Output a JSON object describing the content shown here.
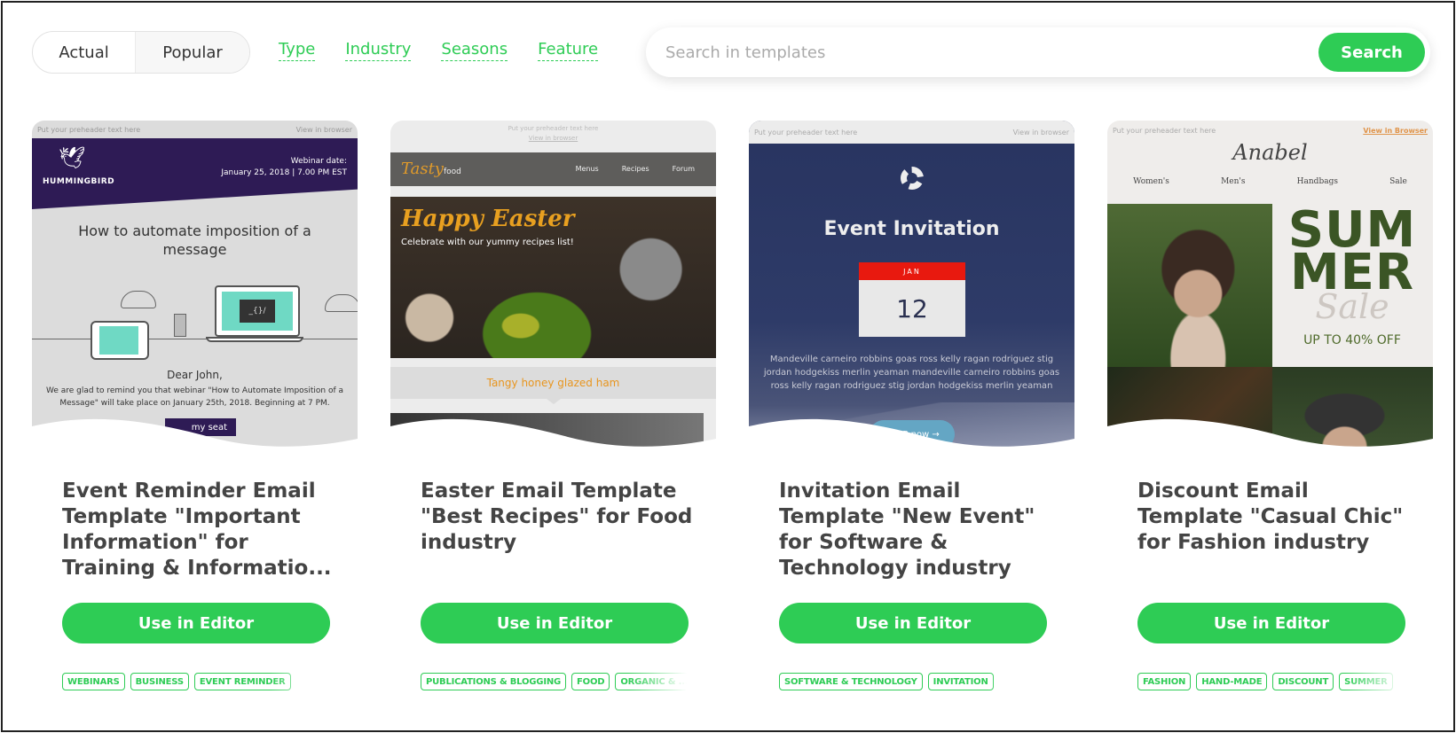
{
  "toolbar": {
    "sort_tabs": [
      {
        "label": "Actual",
        "active": false
      },
      {
        "label": "Popular",
        "active": true
      }
    ],
    "filters": [
      "Type",
      "Industry",
      "Seasons",
      "Feature"
    ],
    "search": {
      "placeholder": "Search in templates",
      "value": "",
      "button_label": "Search"
    }
  },
  "colors": {
    "accent": "#2ecc55",
    "title_text": "#444444"
  },
  "cards": [
    {
      "title": "Event Reminder Email Template \"Important Information\" for Training & Informatio...",
      "button_label": "Use in Editor",
      "tags": [
        "WEBINARS",
        "BUSINESS",
        "EVENT REMINDER"
      ],
      "preview": {
        "preheader": "Put your preheader text here",
        "view_link": "View in browser",
        "brand": "HUMMINGBIRD",
        "webinar_label": "Webinar date:",
        "webinar_date": "January 25, 2018 | 7.00 PM EST",
        "headline": "How to automate imposition of a message",
        "code_glyph": "_{}/",
        "greeting": "Dear John,",
        "body": "We are glad to remind you that webinar \"How to Automate Imposition of a Message\" will take place on January 25th, 2018. Beginning at 7 PM.",
        "cta": "my seat"
      }
    },
    {
      "title": "Easter Email Template \"Best Recipes\" for Food industry",
      "button_label": "Use in Editor",
      "tags": [
        "PUBLICATIONS & BLOGGING",
        "FOOD",
        "ORGANIC & ..."
      ],
      "preview": {
        "preheader": "Put your preheader text here",
        "view_link": "View in browser",
        "logo_script": "Tasty",
        "logo_word": "food",
        "nav": [
          "Menus",
          "Recipes",
          "Forum"
        ],
        "hero_title": "Happy Easter",
        "hero_sub": "Celebrate with our yummy recipes list!",
        "section_title": "Tangy honey glazed ham"
      }
    },
    {
      "title": "Invitation Email Template \"New Event\" for Software & Technology industry",
      "button_label": "Use in Editor",
      "tags": [
        "SOFTWARE & TECHNOLOGY",
        "INVITATION"
      ],
      "preview": {
        "preheader": "Put your preheader text here",
        "view_link": "View in browser",
        "title": "Event Invitation",
        "month": "JAN",
        "day": "12",
        "body": "Mandeville carneiro robbins goas ross kelly ragan rodriguez stig jordan hodgekiss merlin yeaman mandeville carneiro robbins goas ross kelly ragan rodriguez stig jordan hodgekiss merlin yeaman",
        "cta": "RSVP now →"
      }
    },
    {
      "title": "Discount Email Template \"Casual Chic\" for Fashion industry",
      "button_label": "Use in Editor",
      "tags": [
        "FASHION",
        "HAND-MADE",
        "DISCOUNT",
        "SUMMER"
      ],
      "preview": {
        "preheader": "Put your preheader text here",
        "view_link": "View in Browser",
        "brand": "Anabel",
        "nav": [
          "Women's",
          "Men's",
          "Handbags",
          "Sale"
        ],
        "promo_big": "SUM MER",
        "promo_script": "Sale",
        "promo_offer": "UP TO 40% OFF"
      }
    }
  ]
}
